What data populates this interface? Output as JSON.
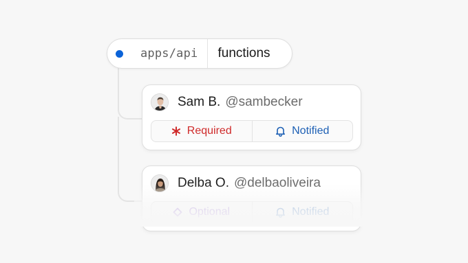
{
  "path": {
    "repo": "apps/api",
    "directory": "functions",
    "status_color": "#0b63d8"
  },
  "reviewers": [
    {
      "name": "Sam B.",
      "handle": "@sambecker",
      "requirement": "Required",
      "requirement_icon": "asterisk-icon",
      "notification": "Notified",
      "notification_icon": "bell-icon"
    },
    {
      "name": "Delba O.",
      "handle": "@delbaoliveira",
      "requirement": "Optional",
      "requirement_icon": "diamond-icon",
      "notification": "Notified",
      "notification_icon": "bell-icon"
    }
  ],
  "colors": {
    "required": "#cf2a2a",
    "optional": "#8b5dcf",
    "notified": "#1c5fb4"
  }
}
